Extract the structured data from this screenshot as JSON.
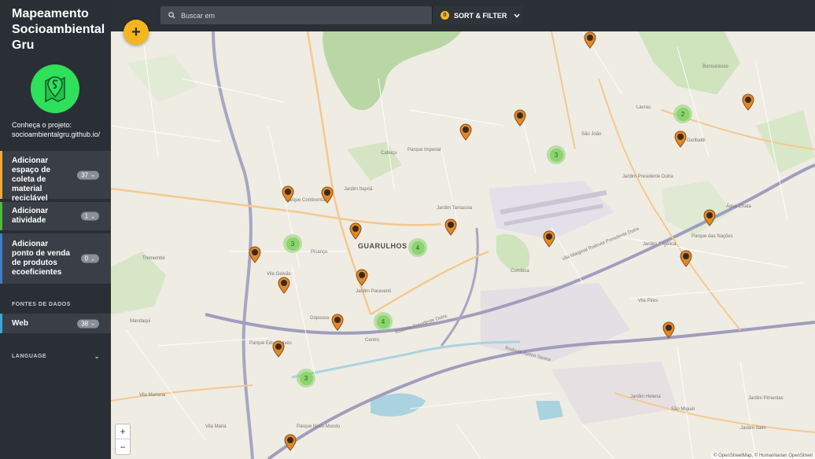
{
  "sidebar": {
    "title": "Mapeamento Socioambiental Gru",
    "project_label": "Conheça o projeto: socioambientalgru.github.io/",
    "categories": [
      {
        "label": "Adicionar espaço de coleta de material reciclável",
        "count": "37",
        "color": "#f3a83a"
      },
      {
        "label": "Adicionar atividade",
        "count": "1",
        "color": "#4cbb3d"
      },
      {
        "label": "Adicionar ponto de venda de produtos ecoeficientes",
        "count": "0",
        "color": "#3f7fc4"
      }
    ],
    "sources_heading": "FONTES DE DADOS",
    "sources": [
      {
        "label": "Web",
        "count": "38",
        "color": "#3aa6d8"
      }
    ],
    "language_heading": "LANGUAGE"
  },
  "topbar": {
    "search_placeholder": "Buscar em",
    "filter_count": "0",
    "sort_filter_label": "SORT & FILTER"
  },
  "map": {
    "city_label": "GUARULHOS",
    "clusters": [
      "2",
      "3",
      "3",
      "4",
      "4",
      "3"
    ],
    "attribution": "© OpenStreetMap, © Humanitarian OpenStreet",
    "zoom_in": "+",
    "zoom_out": "−",
    "labels": [
      "Parque Continental",
      "Jardim Itapoã",
      "Cabuçu",
      "Parque Imperial",
      "Jardim Tamassia",
      "Picanço",
      "Vila Galvão",
      "Jardim Paraventi",
      "Gopouva",
      "Parque Edu Chaves",
      "Centro",
      "Cumbica",
      "Vila Marginal Rodovia Presidente Dutra",
      "Rodovia Presidente Dutra",
      "Rodovia Ayrton Senna",
      "Jardim Presidente Dutra",
      "Parque das Nações",
      "Vila Galvão",
      "Jardim Helena",
      "Lavras",
      "Vila Garibaldi",
      "Bonsucesso",
      "São João",
      "Água Chata",
      "Jardim Angélica",
      "Vila Pires",
      "São Miguel",
      "Vila Mariana",
      "Mandaqui",
      "Tremembé",
      "Parque Novo Mundo",
      "Vila Maria",
      "Jardim Pimentas",
      "Jardim Itaim"
    ],
    "add_button": "+"
  },
  "colors": {
    "accent": "#f3b71d",
    "marker": "#e0892a",
    "cluster": "#8bd46f",
    "sidebar_bg": "#2a2f36"
  }
}
